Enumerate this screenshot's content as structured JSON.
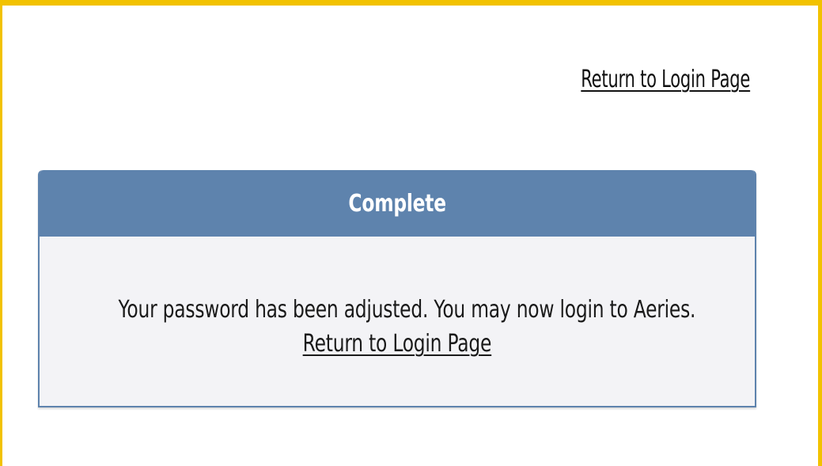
{
  "top_link": {
    "label": "Return to Login Page"
  },
  "panel": {
    "title": "Complete",
    "message": "Your password has been adjusted. You may now login to Aeries.",
    "link_label": "Return to Login Page"
  },
  "colors": {
    "frame_border": "#f2c200",
    "panel_header": "#5e83ad",
    "panel_body": "#f3f3f6"
  }
}
